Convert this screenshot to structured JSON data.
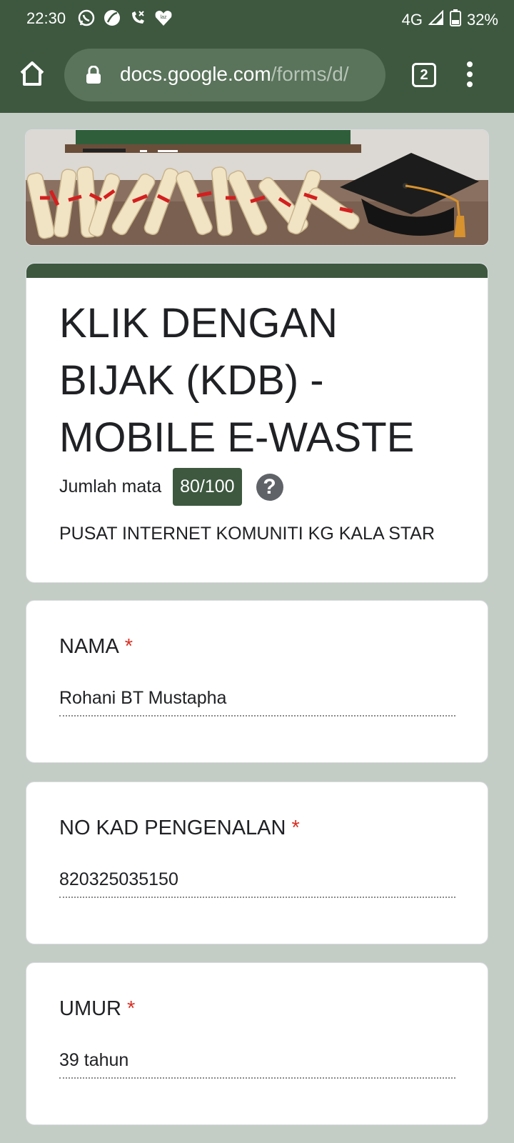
{
  "status_bar": {
    "time": "22:30",
    "network": "4G",
    "battery": "32%",
    "notification_icons": [
      "whatsapp-icon",
      "leaf-app-icon",
      "missed-call-icon",
      "lazada-icon"
    ]
  },
  "browser": {
    "url_host": "docs.google.com",
    "url_path": "/forms/d/",
    "tab_count": "2"
  },
  "form": {
    "title": "KLIK DENGAN BIJAK (KDB) - MOBILE E-WASTE",
    "score_label": "Jumlah mata",
    "score_value": "80/100",
    "description": "PUSAT INTERNET KOMUNITI KG KALA STAR",
    "accent_color": "#3d583f",
    "questions": [
      {
        "label": "NAMA",
        "required_mark": "*",
        "answer": "Rohani BT Mustapha"
      },
      {
        "label": "NO KAD PENGENALAN",
        "required_mark": "*",
        "answer": "820325035150"
      },
      {
        "label": "UMUR",
        "required_mark": "*",
        "answer": "39 tahun"
      }
    ]
  }
}
